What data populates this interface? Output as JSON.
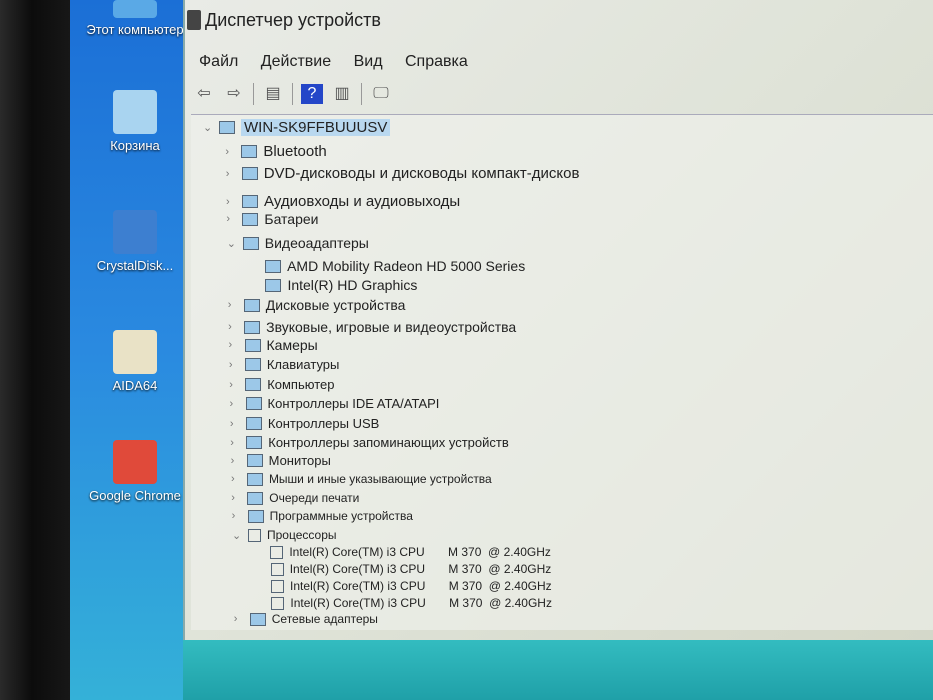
{
  "desktop": {
    "icons": [
      {
        "label": "Этот компьютер",
        "name": "this-pc",
        "color": "#5aa9e6"
      },
      {
        "label": "Корзина",
        "name": "recycle-bin",
        "color": "#a9d4f0"
      },
      {
        "label": "CrystalDisk...",
        "name": "crystaldisk",
        "color": "#3d7fd0"
      },
      {
        "label": "AIDA64",
        "name": "aida64",
        "color": "#e9e2c6"
      },
      {
        "label": "Google Chrome",
        "name": "google-chrome",
        "color": "#e04a3a"
      }
    ]
  },
  "window": {
    "title": "Диспетчер устройств",
    "menu": [
      "Файл",
      "Действие",
      "Вид",
      "Справка"
    ],
    "toolbar": [
      {
        "name": "back",
        "glyph": "⇦"
      },
      {
        "name": "forward",
        "glyph": "⇨"
      },
      {
        "name": "sep"
      },
      {
        "name": "show-hide-tree",
        "glyph": "▤"
      },
      {
        "name": "sep"
      },
      {
        "name": "help",
        "glyph": "?"
      },
      {
        "name": "properties",
        "glyph": "▥"
      },
      {
        "name": "sep"
      },
      {
        "name": "scan-hardware",
        "glyph": "🖵"
      }
    ]
  },
  "tree": [
    {
      "label": "WIN-SK9FFBUUUSV",
      "level": 0,
      "expanded": true,
      "root": true
    },
    {
      "label": "Bluetooth",
      "level": 1
    },
    {
      "label": "DVD-дисководы и дисководы компакт-дисков",
      "level": 1
    },
    {
      "label": "Аудиовходы и аудиовыходы",
      "level": 1
    },
    {
      "label": "Батареи",
      "level": 1
    },
    {
      "label": "Видеоадаптеры",
      "level": 1,
      "expanded": true
    },
    {
      "label": "AMD Mobility Radeon HD 5000 Series",
      "level": 2
    },
    {
      "label": "Intel(R) HD Graphics",
      "level": 2
    },
    {
      "label": "Дисковые устройства",
      "level": 1
    },
    {
      "label": "Звуковые, игровые и видеоустройства",
      "level": 1
    },
    {
      "label": "Камеры",
      "level": 1
    },
    {
      "label": "Клавиатуры",
      "level": 1
    },
    {
      "label": "Компьютер",
      "level": 1
    },
    {
      "label": "Контроллеры IDE ATA/ATAPI",
      "level": 1
    },
    {
      "label": "Контроллеры USB",
      "level": 1
    },
    {
      "label": "Контроллеры запоминающих устройств",
      "level": 1
    },
    {
      "label": "Мониторы",
      "level": 1
    },
    {
      "label": "Мыши и иные указывающие устройства",
      "level": 1
    },
    {
      "label": "Очереди печати",
      "level": 1
    },
    {
      "label": "Программные устройства",
      "level": 1
    },
    {
      "label": "Процессоры",
      "level": 1,
      "expanded": true
    },
    {
      "label": "Intel(R) Core(TM) i3 CPU       M 370  @ 2.40GHz",
      "level": 2
    },
    {
      "label": "Intel(R) Core(TM) i3 CPU       M 370  @ 2.40GHz",
      "level": 2
    },
    {
      "label": "Intel(R) Core(TM) i3 CPU       M 370  @ 2.40GHz",
      "level": 2
    },
    {
      "label": "Intel(R) Core(TM) i3 CPU       M 370  @ 2.40GHz",
      "level": 2
    },
    {
      "label": "Сетевые адаптеры",
      "level": 1
    }
  ]
}
